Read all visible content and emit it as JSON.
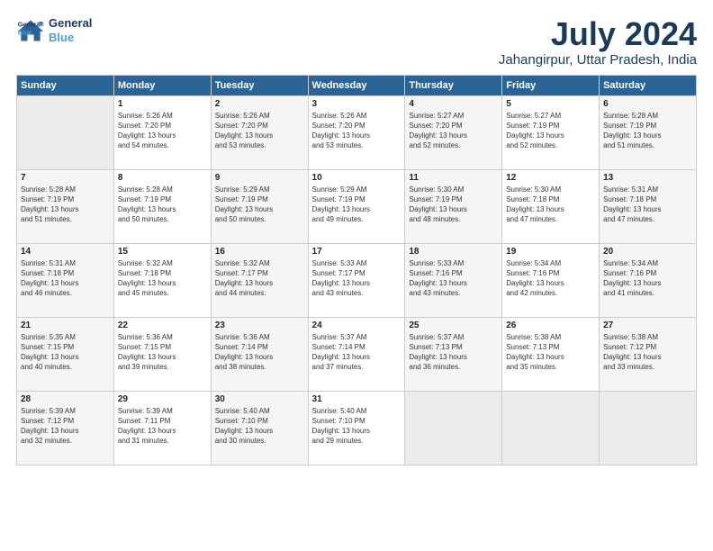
{
  "header": {
    "logo_line1": "General",
    "logo_line2": "Blue",
    "month": "July 2024",
    "location": "Jahangirpur, Uttar Pradesh, India"
  },
  "days_of_week": [
    "Sunday",
    "Monday",
    "Tuesday",
    "Wednesday",
    "Thursday",
    "Friday",
    "Saturday"
  ],
  "weeks": [
    [
      {
        "day": "",
        "info": ""
      },
      {
        "day": "1",
        "info": "Sunrise: 5:26 AM\nSunset: 7:20 PM\nDaylight: 13 hours\nand 54 minutes."
      },
      {
        "day": "2",
        "info": "Sunrise: 5:26 AM\nSunset: 7:20 PM\nDaylight: 13 hours\nand 53 minutes."
      },
      {
        "day": "3",
        "info": "Sunrise: 5:26 AM\nSunset: 7:20 PM\nDaylight: 13 hours\nand 53 minutes."
      },
      {
        "day": "4",
        "info": "Sunrise: 5:27 AM\nSunset: 7:20 PM\nDaylight: 13 hours\nand 52 minutes."
      },
      {
        "day": "5",
        "info": "Sunrise: 5:27 AM\nSunset: 7:19 PM\nDaylight: 13 hours\nand 52 minutes."
      },
      {
        "day": "6",
        "info": "Sunrise: 5:28 AM\nSunset: 7:19 PM\nDaylight: 13 hours\nand 51 minutes."
      }
    ],
    [
      {
        "day": "7",
        "info": "Sunrise: 5:28 AM\nSunset: 7:19 PM\nDaylight: 13 hours\nand 51 minutes."
      },
      {
        "day": "8",
        "info": "Sunrise: 5:28 AM\nSunset: 7:19 PM\nDaylight: 13 hours\nand 50 minutes."
      },
      {
        "day": "9",
        "info": "Sunrise: 5:29 AM\nSunset: 7:19 PM\nDaylight: 13 hours\nand 50 minutes."
      },
      {
        "day": "10",
        "info": "Sunrise: 5:29 AM\nSunset: 7:19 PM\nDaylight: 13 hours\nand 49 minutes."
      },
      {
        "day": "11",
        "info": "Sunrise: 5:30 AM\nSunset: 7:19 PM\nDaylight: 13 hours\nand 48 minutes."
      },
      {
        "day": "12",
        "info": "Sunrise: 5:30 AM\nSunset: 7:18 PM\nDaylight: 13 hours\nand 47 minutes."
      },
      {
        "day": "13",
        "info": "Sunrise: 5:31 AM\nSunset: 7:18 PM\nDaylight: 13 hours\nand 47 minutes."
      }
    ],
    [
      {
        "day": "14",
        "info": "Sunrise: 5:31 AM\nSunset: 7:18 PM\nDaylight: 13 hours\nand 46 minutes."
      },
      {
        "day": "15",
        "info": "Sunrise: 5:32 AM\nSunset: 7:18 PM\nDaylight: 13 hours\nand 45 minutes."
      },
      {
        "day": "16",
        "info": "Sunrise: 5:32 AM\nSunset: 7:17 PM\nDaylight: 13 hours\nand 44 minutes."
      },
      {
        "day": "17",
        "info": "Sunrise: 5:33 AM\nSunset: 7:17 PM\nDaylight: 13 hours\nand 43 minutes."
      },
      {
        "day": "18",
        "info": "Sunrise: 5:33 AM\nSunset: 7:16 PM\nDaylight: 13 hours\nand 43 minutes."
      },
      {
        "day": "19",
        "info": "Sunrise: 5:34 AM\nSunset: 7:16 PM\nDaylight: 13 hours\nand 42 minutes."
      },
      {
        "day": "20",
        "info": "Sunrise: 5:34 AM\nSunset: 7:16 PM\nDaylight: 13 hours\nand 41 minutes."
      }
    ],
    [
      {
        "day": "21",
        "info": "Sunrise: 5:35 AM\nSunset: 7:15 PM\nDaylight: 13 hours\nand 40 minutes."
      },
      {
        "day": "22",
        "info": "Sunrise: 5:36 AM\nSunset: 7:15 PM\nDaylight: 13 hours\nand 39 minutes."
      },
      {
        "day": "23",
        "info": "Sunrise: 5:36 AM\nSunset: 7:14 PM\nDaylight: 13 hours\nand 38 minutes."
      },
      {
        "day": "24",
        "info": "Sunrise: 5:37 AM\nSunset: 7:14 PM\nDaylight: 13 hours\nand 37 minutes."
      },
      {
        "day": "25",
        "info": "Sunrise: 5:37 AM\nSunset: 7:13 PM\nDaylight: 13 hours\nand 36 minutes."
      },
      {
        "day": "26",
        "info": "Sunrise: 5:38 AM\nSunset: 7:13 PM\nDaylight: 13 hours\nand 35 minutes."
      },
      {
        "day": "27",
        "info": "Sunrise: 5:38 AM\nSunset: 7:12 PM\nDaylight: 13 hours\nand 33 minutes."
      }
    ],
    [
      {
        "day": "28",
        "info": "Sunrise: 5:39 AM\nSunset: 7:12 PM\nDaylight: 13 hours\nand 32 minutes."
      },
      {
        "day": "29",
        "info": "Sunrise: 5:39 AM\nSunset: 7:11 PM\nDaylight: 13 hours\nand 31 minutes."
      },
      {
        "day": "30",
        "info": "Sunrise: 5:40 AM\nSunset: 7:10 PM\nDaylight: 13 hours\nand 30 minutes."
      },
      {
        "day": "31",
        "info": "Sunrise: 5:40 AM\nSunset: 7:10 PM\nDaylight: 13 hours\nand 29 minutes."
      },
      {
        "day": "",
        "info": ""
      },
      {
        "day": "",
        "info": ""
      },
      {
        "day": "",
        "info": ""
      }
    ]
  ]
}
